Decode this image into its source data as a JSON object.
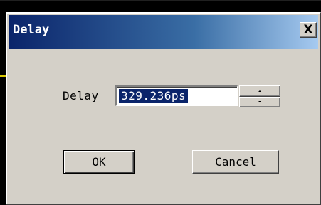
{
  "window": {
    "title": "Delay",
    "close_label": "X"
  },
  "form": {
    "delay_label": "Delay",
    "delay_value": "329.236ps"
  },
  "buttons": {
    "ok_label": "OK",
    "cancel_label": "Cancel"
  },
  "colors": {
    "titlebar_start": "#0a246a",
    "titlebar_end": "#a6caf0",
    "selection": "#0a246a",
    "face": "#d4d0c8",
    "background_trace": "#d8c800"
  }
}
